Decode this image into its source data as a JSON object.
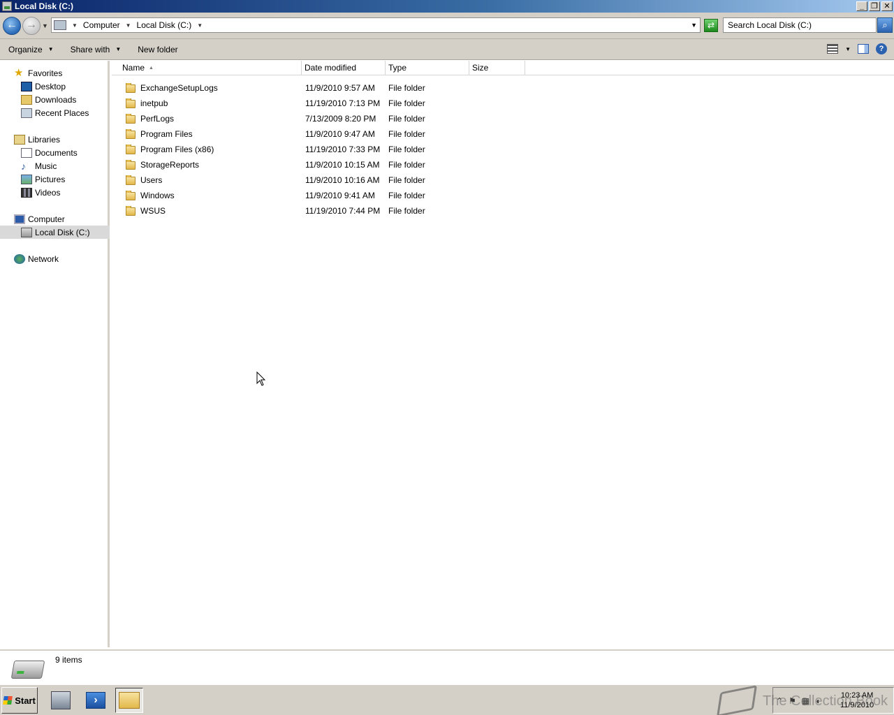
{
  "window": {
    "title": "Local Disk (C:)",
    "controls": {
      "minimize": "_",
      "restore": "❐",
      "close": "✕"
    }
  },
  "address": {
    "breadcrumbs": [
      "Computer",
      "Local Disk (C:)"
    ],
    "search_placeholder": "Search Local Disk (C:)"
  },
  "toolbar": {
    "organize": "Organize",
    "share_with": "Share with",
    "new_folder": "New folder"
  },
  "sidebar": {
    "favorites": {
      "label": "Favorites",
      "items": [
        "Desktop",
        "Downloads",
        "Recent Places"
      ]
    },
    "libraries": {
      "label": "Libraries",
      "items": [
        "Documents",
        "Music",
        "Pictures",
        "Videos"
      ]
    },
    "computer": {
      "label": "Computer",
      "items": [
        "Local Disk (C:)"
      ]
    },
    "network": {
      "label": "Network"
    }
  },
  "columns": [
    "Name",
    "Date modified",
    "Type",
    "Size"
  ],
  "files": [
    {
      "name": "ExchangeSetupLogs",
      "date": "11/9/2010 9:57 AM",
      "type": "File folder",
      "size": ""
    },
    {
      "name": "inetpub",
      "date": "11/19/2010 7:13 PM",
      "type": "File folder",
      "size": ""
    },
    {
      "name": "PerfLogs",
      "date": "7/13/2009 8:20 PM",
      "type": "File folder",
      "size": ""
    },
    {
      "name": "Program Files",
      "date": "11/9/2010 9:47 AM",
      "type": "File folder",
      "size": ""
    },
    {
      "name": "Program Files (x86)",
      "date": "11/19/2010 7:33 PM",
      "type": "File folder",
      "size": ""
    },
    {
      "name": "StorageReports",
      "date": "11/9/2010 10:15 AM",
      "type": "File folder",
      "size": ""
    },
    {
      "name": "Users",
      "date": "11/9/2010 10:16 AM",
      "type": "File folder",
      "size": ""
    },
    {
      "name": "Windows",
      "date": "11/9/2010 9:41 AM",
      "type": "File folder",
      "size": ""
    },
    {
      "name": "WSUS",
      "date": "11/19/2010 7:44 PM",
      "type": "File folder",
      "size": ""
    }
  ],
  "status": {
    "item_count": "9 items"
  },
  "taskbar": {
    "start": "Start",
    "clock_time": "10:23 AM",
    "clock_date": "11/9/2010",
    "watermark": "The Collection Book"
  },
  "colors": {
    "selection": "#d9d9d9",
    "chrome": "#d4d0c8",
    "title_start": "#0a246a"
  }
}
